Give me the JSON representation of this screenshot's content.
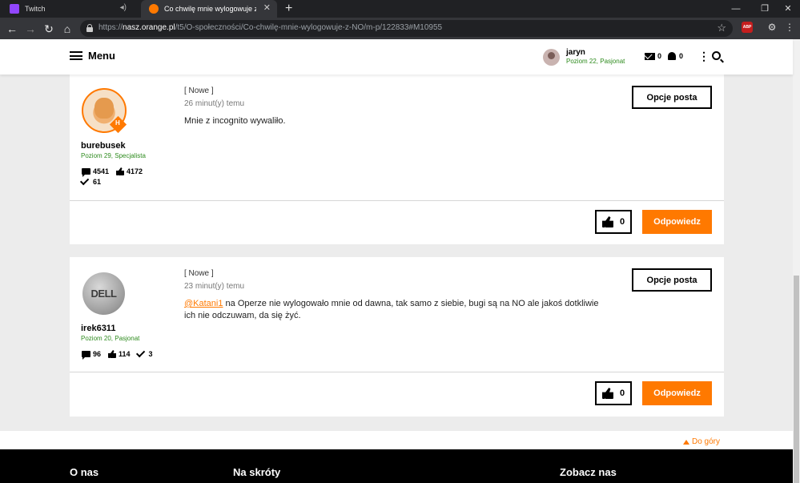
{
  "browser": {
    "tabs": [
      {
        "title": "Twitch",
        "icon": "twitch-icon"
      },
      {
        "title": "Co chwilę mnie wylogowuje z NO",
        "icon": "orange-favicon"
      }
    ],
    "url_scheme": "https://",
    "url_host": "nasz.orange.pl",
    "url_path": "/t5/O-społeczności/Co-chwilę-mnie-wylogowuje-z-NO/m-p/122833#M10955",
    "ext_badge": "ABP"
  },
  "header": {
    "menu_label": "Menu",
    "user_name": "jaryn",
    "user_rank": "Poziom 22, Pasjonat",
    "messages_count": "0",
    "notifications_count": "0"
  },
  "posts": [
    {
      "author": "burebusek",
      "rank": "Poziom 29, Specjalista",
      "badge": "H",
      "stat_messages": "4541",
      "stat_likes": "4172",
      "stat_solutions": "61",
      "new_label": "[ Nowe ]",
      "time": "26 minut(y) temu",
      "body": "Mnie z incognito wywaliło.",
      "options_label": "Opcje posta",
      "likes": "0",
      "reply_label": "Odpowiedz"
    },
    {
      "author": "irek6311",
      "rank": "Poziom 20, Pasjonat",
      "avatar_text": "DELL",
      "stat_messages": "96",
      "stat_likes": "114",
      "stat_solutions": "3",
      "new_label": "[ Nowe ]",
      "time": "23 minut(y) temu",
      "mention": "@Katani1",
      "body": " na Operze nie wylogowało mnie od dawna, tak samo z siebie, bugi są na NO ale jakoś dotkliwie ich nie odczuwam, da się żyć.",
      "options_label": "Opcje posta",
      "likes": "0",
      "reply_label": "Odpowiedz"
    }
  ],
  "to_top_label": "Do góry",
  "footer": {
    "col1": "O nas",
    "col2": "Na skróty",
    "col3": "Zobacz nas"
  },
  "colors": {
    "brand_orange": "#ff7900",
    "rank_green": "#2e8b1e"
  }
}
